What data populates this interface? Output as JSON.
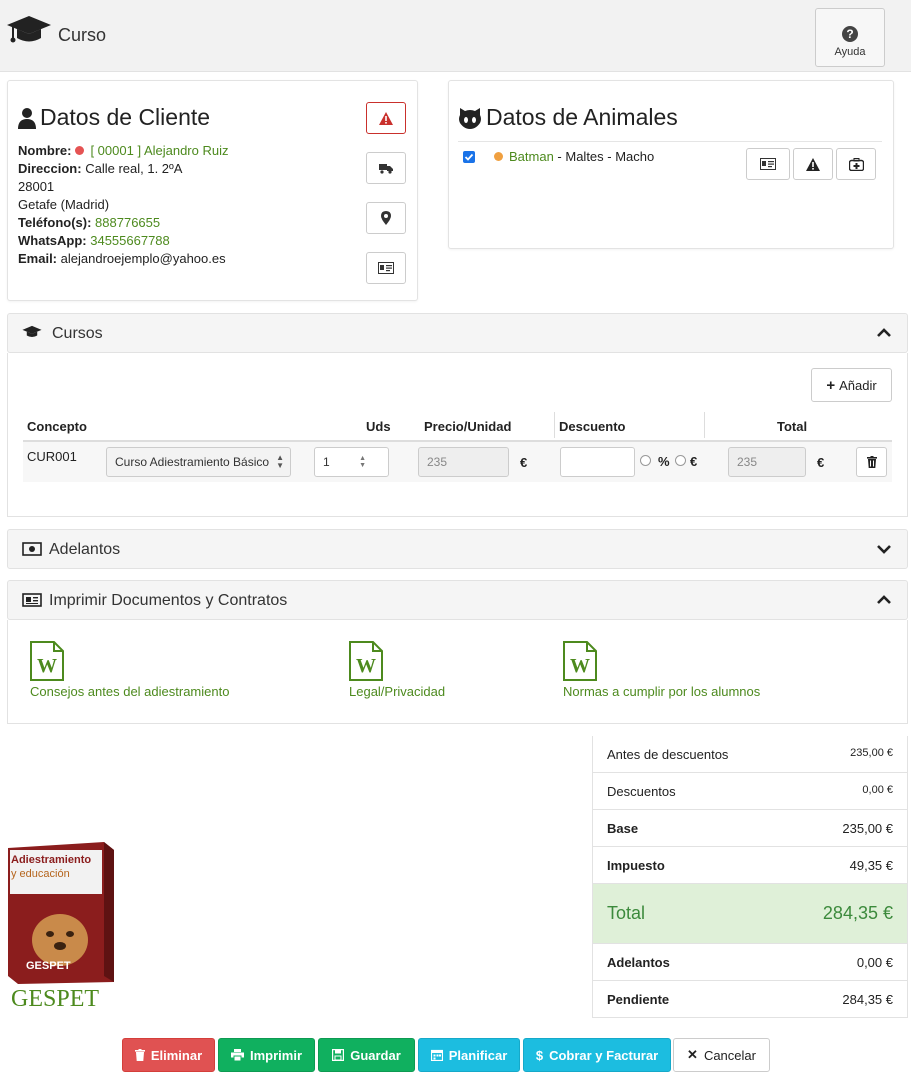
{
  "header": {
    "title": "Curso",
    "help_label": "Ayuda"
  },
  "cliente": {
    "title": "Datos de Cliente",
    "nombre_label": "Nombre:",
    "nombre_value": "[ 00001 ] Alejandro Ruiz",
    "direccion_label": "Direccion:",
    "direccion_value": "Calle real, 1. 2ºA",
    "cp": "28001",
    "ciudad": "Getafe (Madrid)",
    "telefono_label": "Teléfono(s):",
    "telefono_value": "888776655",
    "whatsapp_label": "WhatsApp:",
    "whatsapp_value": "34555667788",
    "email_label": "Email:",
    "email_value": "alejandroejemplo@yahoo.es"
  },
  "animales": {
    "title": "Datos de Animales",
    "animal_name": "Batman",
    "animal_desc": " - Maltes - Macho"
  },
  "cursos": {
    "title": "Cursos",
    "add_label": "Añadir",
    "columns": {
      "concepto": "Concepto",
      "uds": "Uds",
      "precio": "Precio/Unidad",
      "descuento": "Descuento",
      "total": "Total"
    },
    "row": {
      "codigo": "CUR001",
      "curso": "Curso Adiestramiento Básico",
      "uds": "1",
      "precio": "235",
      "descuento": "",
      "pct": "%",
      "eur": "€",
      "total": "235",
      "currency": "€"
    }
  },
  "adelantos": {
    "title": "Adelantos"
  },
  "documentos": {
    "title": "Imprimir Documentos y Contratos",
    "items": [
      "Consejos antes del adiestramiento",
      "Legal/Privacidad",
      "Normas a cumplir por los alumnos"
    ]
  },
  "totales": {
    "antes_label": "Antes de descuentos",
    "antes_value": "235,00 €",
    "descuentos_label": "Descuentos",
    "descuentos_value": "0,00 €",
    "base_label": "Base",
    "base_value": "235,00 €",
    "impuesto_label": "Impuesto",
    "impuesto_value": "49,35 €",
    "total_label": "Total",
    "total_value": "284,35 €",
    "adelantos_label": "Adelantos",
    "adelantos_value": "0,00 €",
    "pendiente_label": "Pendiente",
    "pendiente_value": "284,35 €"
  },
  "logo": {
    "box_line1": "Adiestramiento",
    "box_line2": "y educación",
    "box_brand": "GESPET",
    "wordmark": "GESPET"
  },
  "actions": {
    "eliminar": "Eliminar",
    "imprimir": "Imprimir",
    "guardar": "Guardar",
    "planificar": "Planificar",
    "cobrar": "Cobrar y Facturar",
    "cancelar": "Cancelar"
  },
  "colors": {
    "green_text": "#4d8a1e",
    "total_bg": "#dff0d8",
    "red_dot": "#e55353",
    "orange_dot": "#f0a040"
  }
}
